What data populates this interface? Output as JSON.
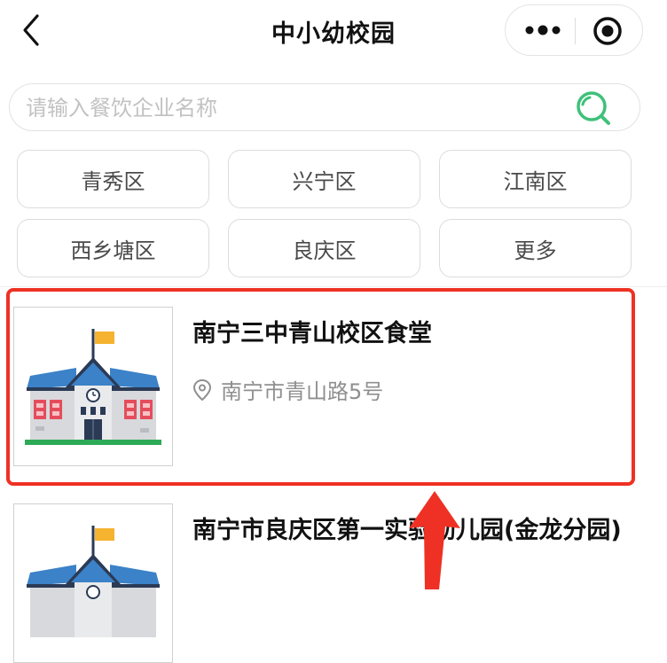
{
  "nav": {
    "title": "中小幼校园",
    "back_icon": "chevron-left-icon",
    "more_icon": "more-dots-icon",
    "close_icon": "target-circle-icon"
  },
  "search": {
    "placeholder": "请输入餐饮企业名称",
    "value": "",
    "icon": "search-icon",
    "accent_color": "#3ec17a"
  },
  "districts": [
    "青秀区",
    "兴宁区",
    "江南区",
    "西乡塘区",
    "良庆区",
    "更多"
  ],
  "results": [
    {
      "name": "南宁三中青山校区食堂",
      "address": "南宁市青山路5号",
      "highlighted": true
    },
    {
      "name": "南宁市良庆区第一实验幼儿园(金龙分园)",
      "address": "",
      "highlighted": false
    }
  ],
  "annotation": {
    "box_color": "#ee3124",
    "arrow_color": "#ee3124"
  }
}
